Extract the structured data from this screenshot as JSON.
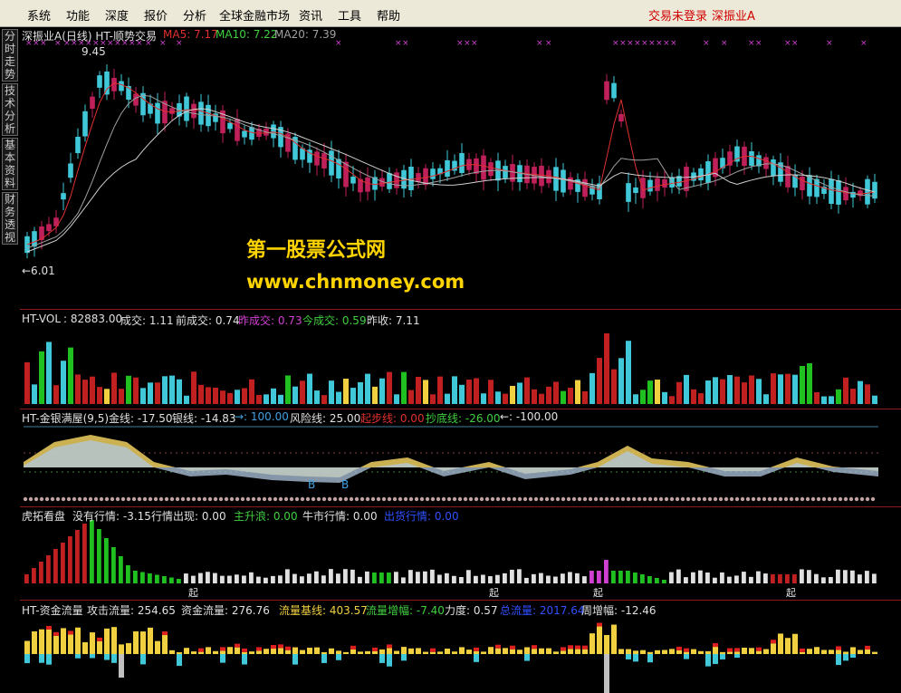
{
  "menu": {
    "items": [
      "系统",
      "功能",
      "深度",
      "报价",
      "分析",
      "全球金融市场",
      "资讯",
      "工具",
      "帮助"
    ],
    "status": "交易未登录",
    "stock": "深振业A"
  },
  "sidetabs": [
    "分时走势",
    "技术分析",
    "基本资料",
    "财务透视"
  ],
  "main": {
    "title": "深振业A(日线) HT-顺势交易",
    "ma5_label": "MA5: 7.17",
    "ma10_label": "MA10: 7.22",
    "ma20_label": "MA20: 7.39",
    "high_label": "9.45",
    "low_label": "←6.01"
  },
  "watermark": {
    "line1": "第一股票公式网",
    "line2": "www.chnmoney.com"
  },
  "vol": {
    "name": "HT-VOL",
    "value": ": 82883.00",
    "chengjiao": "成交: 1.11",
    "qianchengjiao": "前成交: 0.74",
    "zuochengjiao": "昨成交: 0.73",
    "jinchengjiao": "今成交: 0.59",
    "zuoshou": "昨收: 7.11"
  },
  "gold": {
    "name": "HT-金银满屋(9,5)",
    "jinxian": "金线: -17.50",
    "yinxian": "银线: -14.83",
    "arrow1": "→: 100.00",
    "fengxian": "风险线: 25.00",
    "qibu": "起步线: 0.00",
    "chaodi": "抄底线: -26.00",
    "arrow2": "←: -100.00",
    "b_marks": [
      "B",
      "B"
    ]
  },
  "tiger": {
    "name": "虎拓看盘",
    "meiyou": "没有行情: -3.15",
    "chuxian": "行情出现: 0.00",
    "zhusheng": "主升浪: 0.00",
    "niushi": "牛市行情: 0.00",
    "chuhuo": "出货行情: 0.00",
    "qi_marks": [
      "起",
      "起",
      "起",
      "起"
    ]
  },
  "fund": {
    "name": "HT-资金流量",
    "gongji": "攻击流量: 254.65",
    "zijin": "资金流量: 276.76",
    "jixian": "流量基线: 403.57",
    "zengfu": "流量增幅: -7.40",
    "lidu": "力度: 0.57",
    "zongliang": "总流量: 2017.64",
    "zhouzeng": "周增幅: -12.46"
  },
  "colors": {
    "up": "#c0205a",
    "down": "#40c8d8",
    "ma5": "#ffffff",
    "ma10": "#e0c040",
    "ma20": "#40d040",
    "gold": "#f0d060",
    "silver": "#b0c8e0",
    "red": "#e02020",
    "green": "#20c020",
    "yellow": "#f0d040"
  }
}
